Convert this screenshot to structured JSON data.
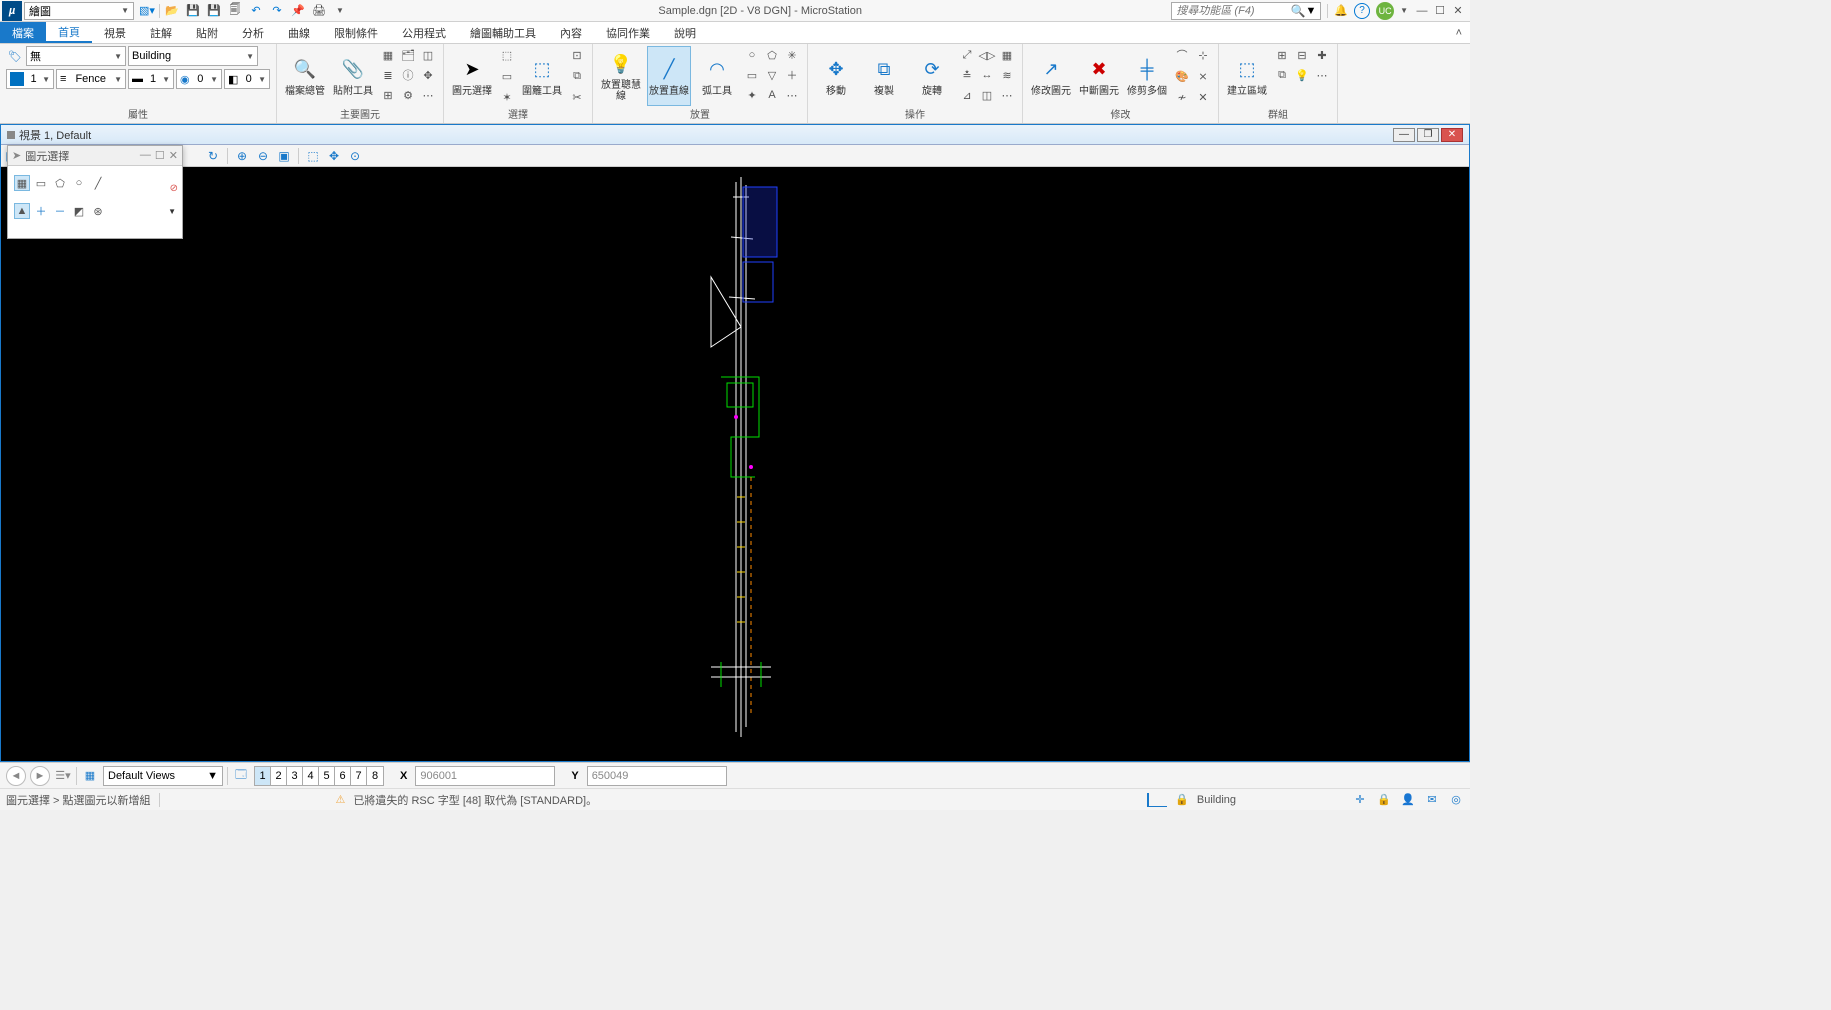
{
  "titlebar": {
    "workflow": "繪圖",
    "app_title": "Sample.dgn [2D - V8 DGN] - MicroStation",
    "search_placeholder": "搜尋功能區 (F4)",
    "user_initials": "UC"
  },
  "menus": {
    "file": "檔案",
    "home": "首頁",
    "view": "視景",
    "annotate": "註解",
    "attach": "貼附",
    "analyze": "分析",
    "curves": "曲線",
    "constraints": "限制條件",
    "utilities": "公用程式",
    "drawing_aids": "繪圖輔助工具",
    "content": "內容",
    "collaborate": "協同作業",
    "help": "說明"
  },
  "ribbon": {
    "attributes": {
      "label": "屬性",
      "template": "無",
      "level": "Building",
      "color_value": "1",
      "linestyle_label": "Fence",
      "weight_value": "1",
      "class_value": "0",
      "transparency_value": "0"
    },
    "primary": {
      "label": "主要圖元",
      "explorer": "檔案總管",
      "attach": "貼附工具"
    },
    "selection": {
      "label": "選擇",
      "element_sel": "圖元選擇",
      "fence": "圍籬工具"
    },
    "placement": {
      "label": "放置",
      "smartline": "放置聰慧線",
      "line": "放置直線",
      "arc": "弧工具"
    },
    "manipulate": {
      "label": "操作",
      "move": "移動",
      "copy": "複製",
      "rotate": "旋轉"
    },
    "modify": {
      "label": "修改",
      "modify_el": "修改圖元",
      "break": "中斷圖元",
      "trim": "修剪多個"
    },
    "groups": {
      "label": "群組",
      "region": "建立區域"
    }
  },
  "view": {
    "title": "視景 1, Default"
  },
  "toolwin": {
    "title": "圖元選擇"
  },
  "bottom": {
    "default_views": "Default Views",
    "view_numbers": [
      "1",
      "2",
      "3",
      "4",
      "5",
      "6",
      "7",
      "8"
    ],
    "x_label": "X",
    "x_value": "906001",
    "y_label": "Y",
    "y_value": "650049"
  },
  "status": {
    "prompt": "圖元選擇 > 點選圖元以新增組",
    "warning": "已將遺失的 RSC 字型 [48] 取代為 [STANDARD]。",
    "active_level": "Building"
  }
}
